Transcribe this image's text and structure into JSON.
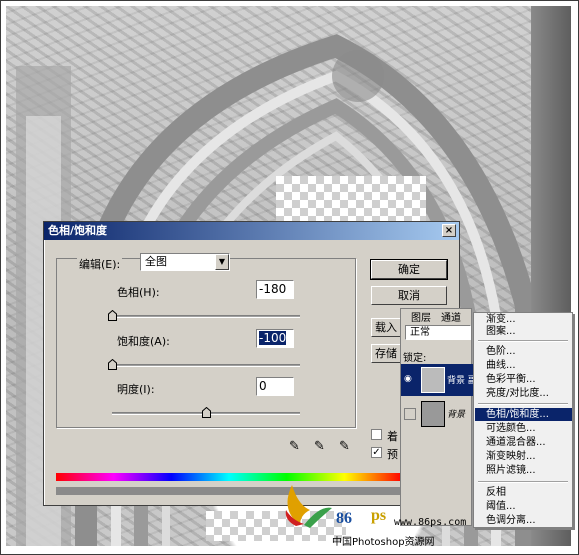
{
  "dialog": {
    "title": "色相/饱和度",
    "close_label": "×",
    "edit_label": "编辑(E):",
    "edit_value": "全图",
    "hue_label": "色相(H):",
    "hue_value": "-180",
    "hue_level": 0.0,
    "saturation_label": "饱和度(A):",
    "saturation_value": "-100",
    "saturation_level": 0.0,
    "lightness_label": "明度(I):",
    "lightness_value": "0",
    "lightness_level": 0.5,
    "ok_label": "确定",
    "cancel_label": "取消",
    "load_label": "载入",
    "save_label": "存储",
    "colorize_label": "着",
    "preview_label": "预",
    "colorize_checked": false,
    "preview_checked": true
  },
  "layers_panel": {
    "tab_layers": "图层",
    "tab_channels": "通道",
    "blend_mode": "正常",
    "lock_label": "锁定:",
    "layer_top": "背景 副",
    "layer_bottom": "背景"
  },
  "adjust_menu": {
    "items": [
      {
        "label": "渐变...",
        "highlighted": false
      },
      {
        "label": "图案...",
        "highlighted": false
      },
      {
        "label": "色阶...",
        "highlighted": false
      },
      {
        "label": "曲线...",
        "highlighted": false
      },
      {
        "label": "色彩平衡...",
        "highlighted": false
      },
      {
        "label": "亮度/对比度...",
        "highlighted": false
      },
      {
        "label": "色相/饱和度...",
        "highlighted": true
      },
      {
        "label": "可选颜色...",
        "highlighted": false
      },
      {
        "label": "通道混合器...",
        "highlighted": false
      },
      {
        "label": "渐变映射...",
        "highlighted": false
      },
      {
        "label": "照片滤镜...",
        "highlighted": false
      },
      {
        "label": "反相",
        "highlighted": false
      },
      {
        "label": "阈值...",
        "highlighted": false
      },
      {
        "label": "色调分离...",
        "highlighted": false
      }
    ]
  },
  "watermark": {
    "num": "86",
    "ps": "ps",
    "url": "www.86ps.com",
    "cn": "中国Photoshop资源网"
  },
  "colors": {
    "title_start": "#0a246a",
    "title_end": "#a6caf0",
    "dialog_bg": "#d4d0c8",
    "menu_highlight": "#0a246a"
  }
}
